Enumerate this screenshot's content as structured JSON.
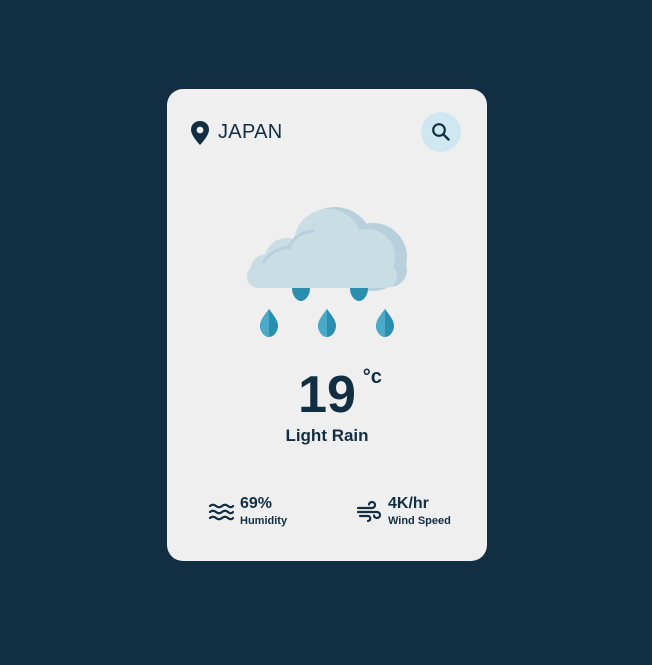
{
  "location": {
    "icon": "location-pin-icon",
    "name": "JAPAN"
  },
  "search": {
    "icon": "search-icon"
  },
  "weather": {
    "icon": "rain-cloud-icon",
    "temperature": "19",
    "unit": "°c",
    "condition": "Light Rain"
  },
  "stats": {
    "humidity": {
      "icon": "waves-icon",
      "value": "69%",
      "label": "Humidity"
    },
    "wind": {
      "icon": "wind-icon",
      "value": "4K/hr",
      "label": "Wind Speed"
    }
  },
  "colors": {
    "background": "#112e42",
    "card": "#efefef",
    "text": "#112e42",
    "search_bg": "#cfe7f0",
    "cloud": "#c9dde5",
    "rain": "#2a8fae"
  }
}
